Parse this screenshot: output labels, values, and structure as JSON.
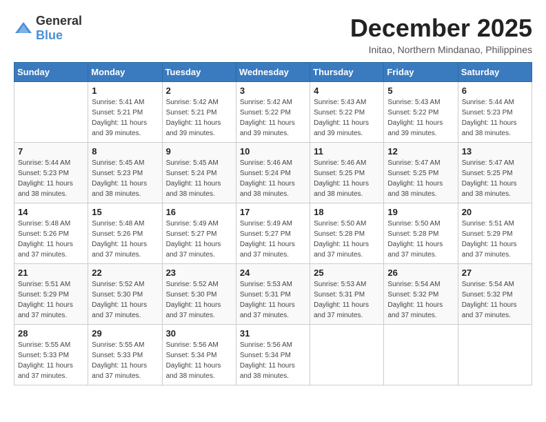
{
  "logo": {
    "general": "General",
    "blue": "Blue"
  },
  "header": {
    "month": "December 2025",
    "location": "Initao, Northern Mindanao, Philippines"
  },
  "weekdays": [
    "Sunday",
    "Monday",
    "Tuesday",
    "Wednesday",
    "Thursday",
    "Friday",
    "Saturday"
  ],
  "weeks": [
    [
      {
        "day": "",
        "sunrise": "",
        "sunset": "",
        "daylight": ""
      },
      {
        "day": "1",
        "sunrise": "Sunrise: 5:41 AM",
        "sunset": "Sunset: 5:21 PM",
        "daylight": "Daylight: 11 hours and 39 minutes."
      },
      {
        "day": "2",
        "sunrise": "Sunrise: 5:42 AM",
        "sunset": "Sunset: 5:21 PM",
        "daylight": "Daylight: 11 hours and 39 minutes."
      },
      {
        "day": "3",
        "sunrise": "Sunrise: 5:42 AM",
        "sunset": "Sunset: 5:22 PM",
        "daylight": "Daylight: 11 hours and 39 minutes."
      },
      {
        "day": "4",
        "sunrise": "Sunrise: 5:43 AM",
        "sunset": "Sunset: 5:22 PM",
        "daylight": "Daylight: 11 hours and 39 minutes."
      },
      {
        "day": "5",
        "sunrise": "Sunrise: 5:43 AM",
        "sunset": "Sunset: 5:22 PM",
        "daylight": "Daylight: 11 hours and 39 minutes."
      },
      {
        "day": "6",
        "sunrise": "Sunrise: 5:44 AM",
        "sunset": "Sunset: 5:23 PM",
        "daylight": "Daylight: 11 hours and 38 minutes."
      }
    ],
    [
      {
        "day": "7",
        "sunrise": "Sunrise: 5:44 AM",
        "sunset": "Sunset: 5:23 PM",
        "daylight": "Daylight: 11 hours and 38 minutes."
      },
      {
        "day": "8",
        "sunrise": "Sunrise: 5:45 AM",
        "sunset": "Sunset: 5:23 PM",
        "daylight": "Daylight: 11 hours and 38 minutes."
      },
      {
        "day": "9",
        "sunrise": "Sunrise: 5:45 AM",
        "sunset": "Sunset: 5:24 PM",
        "daylight": "Daylight: 11 hours and 38 minutes."
      },
      {
        "day": "10",
        "sunrise": "Sunrise: 5:46 AM",
        "sunset": "Sunset: 5:24 PM",
        "daylight": "Daylight: 11 hours and 38 minutes."
      },
      {
        "day": "11",
        "sunrise": "Sunrise: 5:46 AM",
        "sunset": "Sunset: 5:25 PM",
        "daylight": "Daylight: 11 hours and 38 minutes."
      },
      {
        "day": "12",
        "sunrise": "Sunrise: 5:47 AM",
        "sunset": "Sunset: 5:25 PM",
        "daylight": "Daylight: 11 hours and 38 minutes."
      },
      {
        "day": "13",
        "sunrise": "Sunrise: 5:47 AM",
        "sunset": "Sunset: 5:25 PM",
        "daylight": "Daylight: 11 hours and 38 minutes."
      }
    ],
    [
      {
        "day": "14",
        "sunrise": "Sunrise: 5:48 AM",
        "sunset": "Sunset: 5:26 PM",
        "daylight": "Daylight: 11 hours and 37 minutes."
      },
      {
        "day": "15",
        "sunrise": "Sunrise: 5:48 AM",
        "sunset": "Sunset: 5:26 PM",
        "daylight": "Daylight: 11 hours and 37 minutes."
      },
      {
        "day": "16",
        "sunrise": "Sunrise: 5:49 AM",
        "sunset": "Sunset: 5:27 PM",
        "daylight": "Daylight: 11 hours and 37 minutes."
      },
      {
        "day": "17",
        "sunrise": "Sunrise: 5:49 AM",
        "sunset": "Sunset: 5:27 PM",
        "daylight": "Daylight: 11 hours and 37 minutes."
      },
      {
        "day": "18",
        "sunrise": "Sunrise: 5:50 AM",
        "sunset": "Sunset: 5:28 PM",
        "daylight": "Daylight: 11 hours and 37 minutes."
      },
      {
        "day": "19",
        "sunrise": "Sunrise: 5:50 AM",
        "sunset": "Sunset: 5:28 PM",
        "daylight": "Daylight: 11 hours and 37 minutes."
      },
      {
        "day": "20",
        "sunrise": "Sunrise: 5:51 AM",
        "sunset": "Sunset: 5:29 PM",
        "daylight": "Daylight: 11 hours and 37 minutes."
      }
    ],
    [
      {
        "day": "21",
        "sunrise": "Sunrise: 5:51 AM",
        "sunset": "Sunset: 5:29 PM",
        "daylight": "Daylight: 11 hours and 37 minutes."
      },
      {
        "day": "22",
        "sunrise": "Sunrise: 5:52 AM",
        "sunset": "Sunset: 5:30 PM",
        "daylight": "Daylight: 11 hours and 37 minutes."
      },
      {
        "day": "23",
        "sunrise": "Sunrise: 5:52 AM",
        "sunset": "Sunset: 5:30 PM",
        "daylight": "Daylight: 11 hours and 37 minutes."
      },
      {
        "day": "24",
        "sunrise": "Sunrise: 5:53 AM",
        "sunset": "Sunset: 5:31 PM",
        "daylight": "Daylight: 11 hours and 37 minutes."
      },
      {
        "day": "25",
        "sunrise": "Sunrise: 5:53 AM",
        "sunset": "Sunset: 5:31 PM",
        "daylight": "Daylight: 11 hours and 37 minutes."
      },
      {
        "day": "26",
        "sunrise": "Sunrise: 5:54 AM",
        "sunset": "Sunset: 5:32 PM",
        "daylight": "Daylight: 11 hours and 37 minutes."
      },
      {
        "day": "27",
        "sunrise": "Sunrise: 5:54 AM",
        "sunset": "Sunset: 5:32 PM",
        "daylight": "Daylight: 11 hours and 37 minutes."
      }
    ],
    [
      {
        "day": "28",
        "sunrise": "Sunrise: 5:55 AM",
        "sunset": "Sunset: 5:33 PM",
        "daylight": "Daylight: 11 hours and 37 minutes."
      },
      {
        "day": "29",
        "sunrise": "Sunrise: 5:55 AM",
        "sunset": "Sunset: 5:33 PM",
        "daylight": "Daylight: 11 hours and 37 minutes."
      },
      {
        "day": "30",
        "sunrise": "Sunrise: 5:56 AM",
        "sunset": "Sunset: 5:34 PM",
        "daylight": "Daylight: 11 hours and 38 minutes."
      },
      {
        "day": "31",
        "sunrise": "Sunrise: 5:56 AM",
        "sunset": "Sunset: 5:34 PM",
        "daylight": "Daylight: 11 hours and 38 minutes."
      },
      {
        "day": "",
        "sunrise": "",
        "sunset": "",
        "daylight": ""
      },
      {
        "day": "",
        "sunrise": "",
        "sunset": "",
        "daylight": ""
      },
      {
        "day": "",
        "sunrise": "",
        "sunset": "",
        "daylight": ""
      }
    ]
  ]
}
